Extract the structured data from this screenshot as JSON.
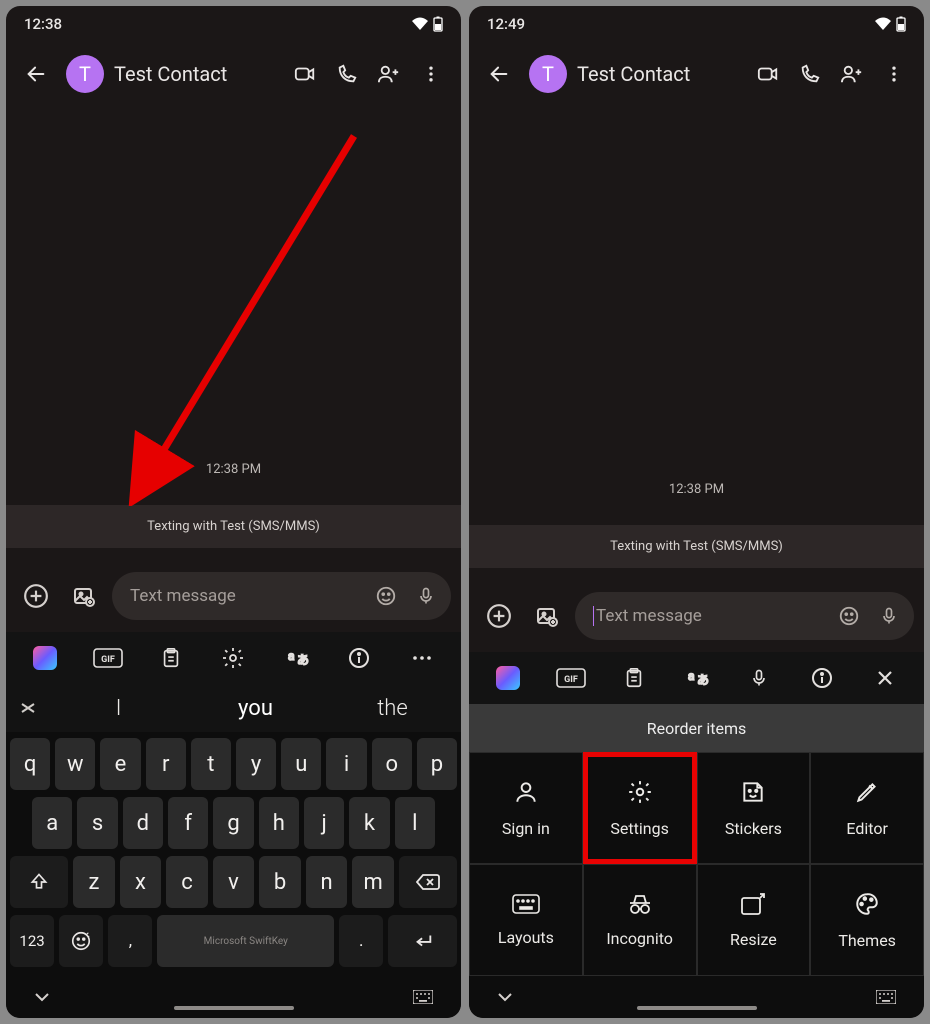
{
  "left": {
    "status_time": "12:38",
    "contact_initial": "T",
    "contact_name": "Test Contact",
    "msg_timestamp": "12:38 PM",
    "texting_banner": "Texting with Test (SMS/MMS)",
    "input_placeholder": "Text message",
    "suggestions": {
      "s0": "I",
      "s1": "you",
      "s2": "the"
    },
    "keys": {
      "r1": [
        "q",
        "w",
        "e",
        "r",
        "t",
        "y",
        "u",
        "i",
        "o",
        "p"
      ],
      "r2": [
        "a",
        "s",
        "d",
        "f",
        "g",
        "h",
        "j",
        "k",
        "l"
      ],
      "r3": [
        "z",
        "x",
        "c",
        "v",
        "b",
        "n",
        "m"
      ],
      "mode": "123",
      "space_label": "Microsoft SwiftKey"
    }
  },
  "right": {
    "status_time": "12:49",
    "contact_initial": "T",
    "contact_name": "Test Contact",
    "msg_timestamp": "12:38 PM",
    "texting_banner": "Texting with Test (SMS/MMS)",
    "input_placeholder": "Text message",
    "reorder_title": "Reorder items",
    "grid": {
      "signin": "Sign in",
      "settings": "Settings",
      "stickers": "Stickers",
      "editor": "Editor",
      "layouts": "Layouts",
      "incognito": "Incognito",
      "resize": "Resize",
      "themes": "Themes"
    }
  }
}
